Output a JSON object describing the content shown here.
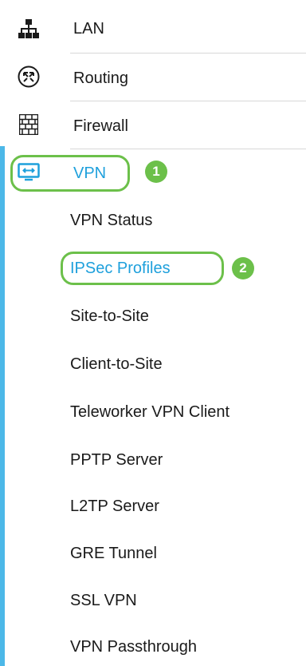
{
  "nav": {
    "items": [
      {
        "label": "LAN",
        "icon": "network-tree-icon"
      },
      {
        "label": "Routing",
        "icon": "routing-arrows-icon"
      },
      {
        "label": "Firewall",
        "icon": "firewall-brick-icon"
      },
      {
        "label": "VPN",
        "icon": "vpn-monitor-icon"
      }
    ],
    "vpn_subitems": [
      "VPN Status",
      "IPSec Profiles",
      "Site-to-Site",
      "Client-to-Site",
      "Teleworker VPN Client",
      "PPTP Server",
      "L2TP Server",
      "GRE Tunnel",
      "SSL VPN",
      "VPN Passthrough"
    ],
    "active_subitem": "IPSec Profiles"
  },
  "annotations": {
    "step1": "1",
    "step2": "2"
  },
  "colors": {
    "accent_blue": "#1ea0dc",
    "sidebar_bar": "#4cb8e8",
    "highlight_green": "#6cc04a",
    "text": "#1a1a1a"
  }
}
